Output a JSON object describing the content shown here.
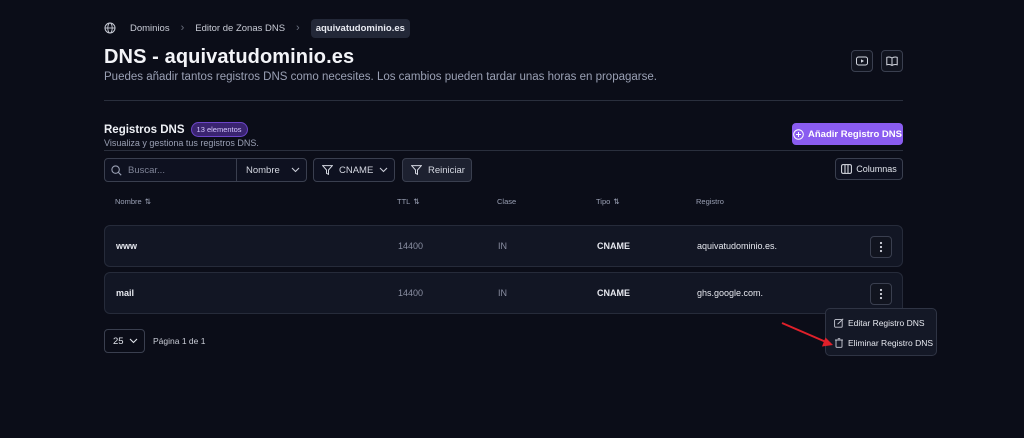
{
  "breadcrumb": {
    "items": [
      "Dominios",
      "Editor de Zonas DNS"
    ],
    "current": "aquivatudominio.es"
  },
  "page": {
    "title": "DNS - aquivatudominio.es",
    "subtitle": "Puedes añadir tantos registros DNS como necesites. Los cambios pueden tardar unas horas en propagarse."
  },
  "section": {
    "title": "Registros DNS",
    "badge": "13 elementos",
    "description": "Visualiza y gestiona tus registros DNS.",
    "add_button": "Añadir Registro DNS"
  },
  "toolbar": {
    "search_placeholder": "Buscar...",
    "search_field": "Nombre",
    "type_filter": "CNAME",
    "reset": "Reiniciar",
    "columns": "Columnas"
  },
  "table": {
    "headers": {
      "name": "Nombre",
      "ttl": "TTL",
      "class": "Clase",
      "type": "Tipo",
      "record": "Registro"
    },
    "rows": [
      {
        "name": "www",
        "ttl": "14400",
        "class": "IN",
        "type": "CNAME",
        "record": "aquivatudominio.es."
      },
      {
        "name": "mail",
        "ttl": "14400",
        "class": "IN",
        "type": "CNAME",
        "record": "ghs.google.com."
      }
    ]
  },
  "pagination": {
    "page_size": "25",
    "label": "Página 1 de 1"
  },
  "context_menu": {
    "edit": "Editar Registro DNS",
    "delete": "Eliminar Registro DNS"
  },
  "colors": {
    "accent": "#8a5cf0",
    "background": "#0b0d18",
    "arrow": "#e0202a"
  }
}
